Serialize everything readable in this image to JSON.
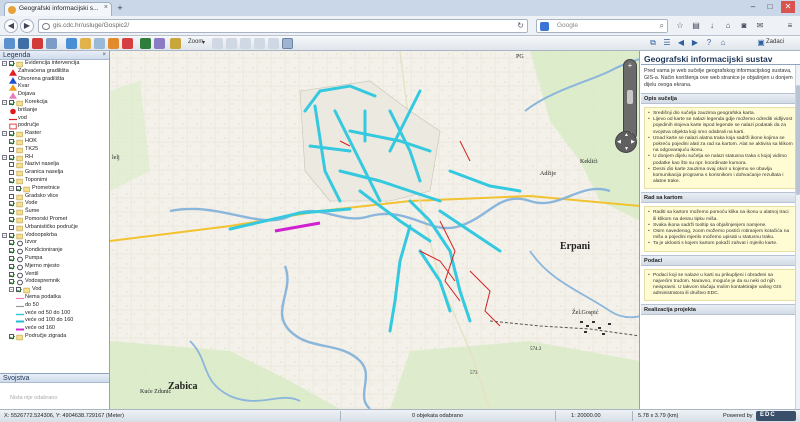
{
  "browser": {
    "tab_title": "Geografski informacijski s...",
    "new_tab": "+",
    "url": "gis.cdc.hr/usluge/Gospic2/",
    "search_placeholder": "Google",
    "win_min": "–",
    "win_max": "□",
    "win_close": "✕"
  },
  "toolbar": {
    "zoom_label": "Zoom",
    "hide_label": "Zadaci"
  },
  "legend": {
    "title": "Legenda",
    "items": [
      {
        "label": "Evidencija intervencija",
        "kind": "group",
        "level": 0,
        "checked": true
      },
      {
        "label": "Zahvaćena gradilišta",
        "kind": "tri-red",
        "level": 1
      },
      {
        "label": "Otvorena gradilišta",
        "kind": "tri-blue",
        "level": 1
      },
      {
        "label": "Kvar",
        "kind": "tri-orange",
        "level": 1
      },
      {
        "label": "Dojava",
        "kind": "tri-pink",
        "level": 1
      },
      {
        "label": "Korekcija",
        "kind": "group",
        "level": 0,
        "checked": true
      },
      {
        "label": "brišanje",
        "kind": "dot-red",
        "level": 1
      },
      {
        "label": "vod",
        "kind": "line-red",
        "level": 1
      },
      {
        "label": "područje",
        "kind": "box-red",
        "level": 1
      },
      {
        "label": "Raster",
        "kind": "group",
        "level": 0,
        "checked": true
      },
      {
        "label": "HOK",
        "kind": "layer",
        "level": 1,
        "checked": true
      },
      {
        "label": "TK25",
        "kind": "layer",
        "level": 1,
        "checked": false
      },
      {
        "label": "RH",
        "kind": "group",
        "level": 0,
        "checked": true
      },
      {
        "label": "Nazivi naselja",
        "kind": "layer",
        "level": 1,
        "checked": false
      },
      {
        "label": "Granica naselja",
        "kind": "layer",
        "level": 1,
        "checked": false
      },
      {
        "label": "Toponimi",
        "kind": "layer",
        "level": 1,
        "checked": true
      },
      {
        "label": "Prometnice",
        "kind": "group",
        "level": 1,
        "checked": true
      },
      {
        "label": "Gradsko vlice",
        "kind": "layer",
        "level": 1,
        "checked": false
      },
      {
        "label": "Vode",
        "kind": "layer",
        "level": 1,
        "checked": true
      },
      {
        "label": "Šume",
        "kind": "layer",
        "level": 1,
        "checked": true
      },
      {
        "label": "Pomorski Promet",
        "kind": "layer",
        "level": 1,
        "checked": true
      },
      {
        "label": "Urbanističko područje",
        "kind": "layer",
        "level": 1,
        "checked": false
      },
      {
        "label": "Vodoopskrba",
        "kind": "group",
        "level": 0,
        "checked": true
      },
      {
        "label": "Izvor",
        "kind": "layer-icon",
        "level": 1,
        "checked": true
      },
      {
        "label": "Kondicioniranje",
        "kind": "layer-icon",
        "level": 1,
        "checked": true
      },
      {
        "label": "Pumpa",
        "kind": "layer-icon",
        "level": 1,
        "checked": true
      },
      {
        "label": "Mjerno mjesto",
        "kind": "layer-icon",
        "level": 1,
        "checked": true
      },
      {
        "label": "Ventil",
        "kind": "layer-icon",
        "level": 1,
        "checked": true
      },
      {
        "label": "Vodospremnik",
        "kind": "layer-icon",
        "level": 1,
        "checked": true
      },
      {
        "label": "Vod",
        "kind": "group",
        "level": 1,
        "checked": true
      },
      {
        "label": "Nema podatka",
        "kind": "line-pink",
        "level": 2
      },
      {
        "label": "do 50",
        "kind": "line-grey",
        "level": 2
      },
      {
        "label": "veće od 50 do 100",
        "kind": "line-cyan",
        "level": 2
      },
      {
        "label": "veće od 100 do 160",
        "kind": "line-cyan2",
        "level": 2
      },
      {
        "label": "veće od 160",
        "kind": "line-magenta",
        "level": 2
      },
      {
        "label": "Područje zigrada",
        "kind": "layer",
        "level": 1,
        "checked": true
      }
    ]
  },
  "properties": {
    "title": "Svojstva",
    "hint": "Nista nije odabrano"
  },
  "map": {
    "labels": {
      "zabica": "Zabica",
      "kuce_zdunic": "Kuće Zdunić",
      "erpani": "Erpani",
      "adzije": "Adžije",
      "kekici": "Keklići",
      "zel_gospic": "Žel.Gospić",
      "lelj": "lelj",
      "pg": "PG",
      "h574": "574.3",
      "h573": "573"
    }
  },
  "info": {
    "title": "Geografski informacijski sustav",
    "intro": "Pred vama je web sučelje geografskog informacijskog sustava, GIS-a. Način korištenja ove web stranice je objašnjen u donjem dijelu ovoga ekrana.",
    "sections": [
      {
        "heading": "Opis sučelja",
        "bullets": [
          "Središnji dio sučelja zauzima geografska karta.",
          "Lijevo od karte se nalazi legenda gdje možemo odrediti vidljivost pojedinih slojeva karte ispod legende se nalazi podatak da za svojstva objekta koji smo odabrali na karti.",
          "Iznad karte se nalazi alatna traka koja sadrži ikone kojima se pokreću pojedini alati za rad sa kartom. Alat se aktivira sa klikom na odgovarajuću ikonu.",
          "U donjem dijelu sučelja se nalazi statusna traka s kojoj vidimo podatke kao što su npr. koordinate kursora.",
          "Desni dio karte zauzima ovaj okvir u kojemu se obavlja komunikacija programa s korisnikom i dohvaćanje rezultata i alatne trake."
        ]
      },
      {
        "heading": "Rad sa kartom",
        "bullets": [
          "Raditi sa kartom možemo pomoću klika na ikonu u alatnoj traci ili klikom na desnu tipku miša.",
          "Svaka ikona sadrži tooltip sa objašnjenjem namjene.",
          "Osim navedenog, zoom možemo postići rotiranjem kotačića na mišu a pojedini mjerilo možemo upisati u statusnu traku.",
          "Ta je ukloniti s kojem kartom pokaži zahvat i mjerilo karte."
        ]
      },
      {
        "heading": "Podaci",
        "bullets": [
          "Podaci koji se nalaze u karti su prikupljeni i obrađeni sa najvećim trudom. Naravno, moguće je da su neki od njih neispravni. U takvom slučaju molim kontaktirajte vašeg GIS administratora ili društvo EDC."
        ]
      },
      {
        "heading": "Realizacija projekta",
        "bullets": []
      }
    ]
  },
  "status": {
    "coords": "X: 5526772.524306, Y: 4904638.729167 (Meter)",
    "selected": "0 objekata odabrano",
    "scale": "1: 20000.00",
    "extent": "5.78 x 3.79 (km)",
    "powered": "Powered by",
    "logo": "EDC"
  },
  "colors": {
    "cyan": "#35c9e0",
    "red": "#d42020",
    "magenta": "#d020d0",
    "river": "#8bb6dc"
  }
}
